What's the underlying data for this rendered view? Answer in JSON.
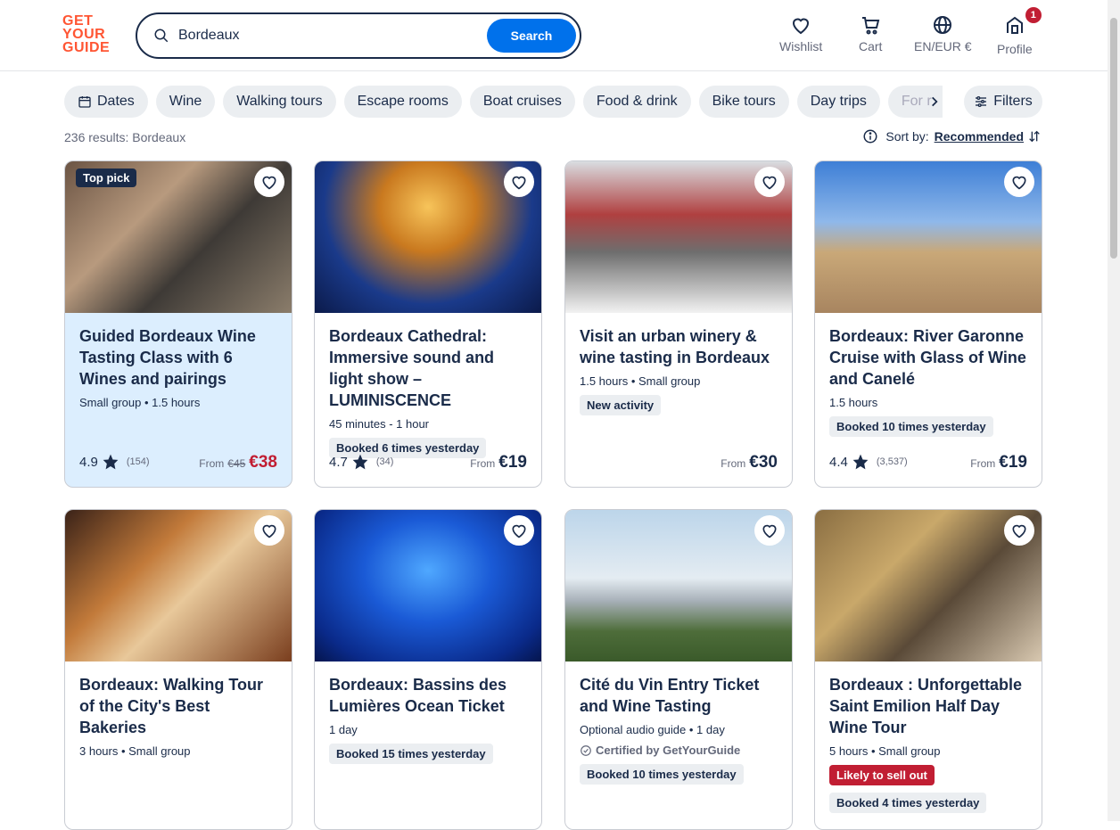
{
  "header": {
    "logo_text": "GET YOUR GUIDE",
    "search_value": "Bordeaux",
    "search_button": "Search",
    "nav": {
      "wishlist": "Wishlist",
      "cart": "Cart",
      "locale": "EN/EUR €",
      "profile": "Profile",
      "profile_badge": "1"
    }
  },
  "filters": {
    "chips": [
      "Dates",
      "Wine",
      "Walking tours",
      "Escape rooms",
      "Boat cruises",
      "Food & drink",
      "Bike tours",
      "Day trips",
      "For r"
    ],
    "filters_button": "Filters"
  },
  "results": {
    "count_text": "236 results: Bordeaux",
    "sort_label": "Sort by:",
    "sort_value": "Recommended"
  },
  "colors": {
    "brand": "#ff5533",
    "primary": "#0071eb",
    "sale": "#c11e33",
    "dark": "#1a2b49"
  },
  "cards": [
    {
      "title": "Guided Bordeaux Wine Tasting Class with 6 Wines and pairings",
      "meta": "Small group • 1.5 hours",
      "badge": "Top pick",
      "rating": "4.9",
      "reviews": "(154)",
      "from": "From",
      "old_price": "€45",
      "price": "€38"
    },
    {
      "title": "Bordeaux Cathedral: Immersive sound and light show – LUMINISCENCE",
      "meta": "45 minutes - 1 hour",
      "tag": "Booked 6 times yesterday",
      "rating": "4.7",
      "reviews": "(34)",
      "from": "From",
      "price": "€19"
    },
    {
      "title": "Visit an urban winery & wine tasting in Bordeaux",
      "meta": "1.5 hours • Small group",
      "tag": "New activity",
      "from": "From",
      "price": "€30"
    },
    {
      "title": "Bordeaux: River Garonne Cruise with Glass of Wine and Canelé",
      "meta": "1.5 hours",
      "tag": "Booked 10 times yesterday",
      "rating": "4.4",
      "reviews": "(3,537)",
      "from": "From",
      "price": "€19"
    },
    {
      "title": "Bordeaux: Walking Tour of the City's Best Bakeries",
      "meta": "3 hours • Small group"
    },
    {
      "title": "Bordeaux: Bassins des Lumières Ocean Ticket",
      "meta": "1 day",
      "tag": "Booked 15 times yesterday"
    },
    {
      "title": "Cité du Vin Entry Ticket and Wine Tasting",
      "meta": "Optional audio guide • 1 day",
      "cert": "Certified by GetYourGuide",
      "tag": "Booked 10 times yesterday"
    },
    {
      "title": "Bordeaux : Unforgettable Saint Emilion Half Day Wine Tour",
      "meta": "5 hours • Small group",
      "tag_red": "Likely to sell out",
      "tag": "Booked 4 times yesterday"
    }
  ]
}
